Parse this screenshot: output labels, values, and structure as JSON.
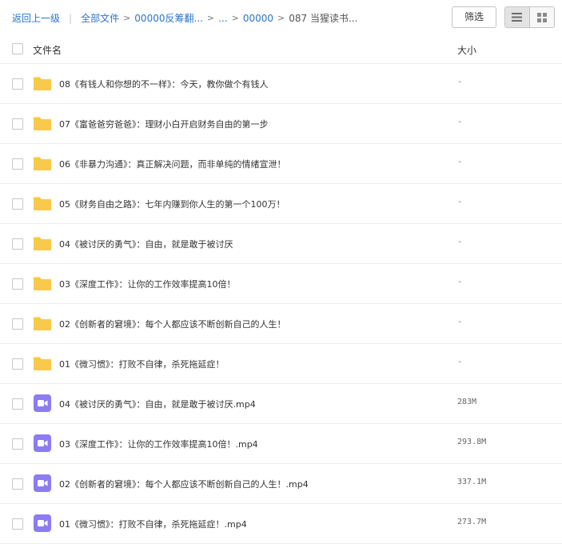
{
  "breadcrumb": {
    "back": "返回上一级",
    "all_files": "全部文件",
    "path1": "00000反筹翻...",
    "ellipsis": "...",
    "path2": "00000",
    "current": "087 当猩读书..."
  },
  "toolbar": {
    "filter_label": "筛选"
  },
  "table": {
    "col_name": "文件名",
    "col_size": "大小"
  },
  "colors": {
    "folder": "#f8c94a",
    "video": "#8c7cf2",
    "link": "#2a75c9"
  },
  "files": [
    {
      "name": "08《有钱人和你想的不一样》：今天，教你做个有钱人",
      "size": "-",
      "type": "folder"
    },
    {
      "name": "07《富爸爸穷爸爸》：理财小白开启财务自由的第一步",
      "size": "-",
      "type": "folder"
    },
    {
      "name": "06《非暴力沟通》：真正解决问题，而非单纯的情绪宣泄！",
      "size": "-",
      "type": "folder"
    },
    {
      "name": "05《财务自由之路》：七年内赚到你人生的第一个100万！",
      "size": "-",
      "type": "folder"
    },
    {
      "name": "04《被讨厌的勇气》：自由，就是敢于被讨厌",
      "size": "-",
      "type": "folder"
    },
    {
      "name": "03《深度工作》：让你的工作效率提高10倍！",
      "size": "-",
      "type": "folder"
    },
    {
      "name": "02《创新者的窘境》：每个人都应该不断创新自己的人生！",
      "size": "-",
      "type": "folder"
    },
    {
      "name": "01《微习惯》：打败不自律，杀死拖延症！",
      "size": "-",
      "type": "folder"
    },
    {
      "name": "04《被讨厌的勇气》：自由，就是敢于被讨厌.mp4",
      "size": "283M",
      "type": "video"
    },
    {
      "name": "03《深度工作》：让你的工作效率提高10倍！.mp4",
      "size": "293.8M",
      "type": "video"
    },
    {
      "name": "02《创新者的窘境》：每个人都应该不断创新自己的人生！.mp4",
      "size": "337.1M",
      "type": "video"
    },
    {
      "name": "01《微习惯》：打败不自律，杀死拖延症！.mp4",
      "size": "273.7M",
      "type": "video"
    }
  ]
}
